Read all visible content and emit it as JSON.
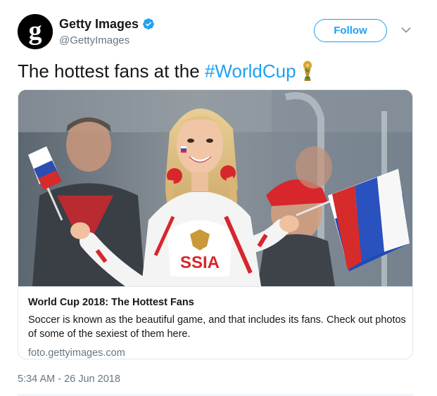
{
  "author": {
    "display_name": "Getty Images",
    "handle": "@GettyImages",
    "avatar_letter": "g",
    "verified": true
  },
  "actions": {
    "follow_label": "Follow"
  },
  "tweet": {
    "text": "The hottest fans at the ",
    "hashtag": "#WorldCup",
    "timestamp": "5:34 AM - 26 Jun 2018"
  },
  "card": {
    "title": "World Cup 2018: The Hottest Fans",
    "description": "Soccer is known as the beautiful game, and that includes its fans. Check out photos of some of the sexiest of them here.",
    "domain": "foto.gettyimages.com",
    "shirt_text": "SSIA"
  },
  "colors": {
    "accent": "#1da1f2",
    "text": "#14171a",
    "secondary_text": "#657786",
    "border": "#e1e8ed"
  },
  "icons": {
    "verified": "verified-badge-icon",
    "menu": "chevron-down-icon",
    "emoji": "trophy-icon"
  }
}
